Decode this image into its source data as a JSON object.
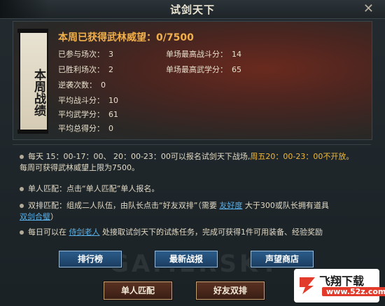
{
  "window": {
    "title": "试剑天下",
    "close_glyph": "✕"
  },
  "stats_panel": {
    "banner_text": "本周战绩",
    "prestige_label": "本周已获得武林威望：",
    "prestige_value": "0/7500",
    "left": [
      {
        "label": "已参与场次：",
        "value": "3"
      },
      {
        "label": "已胜利场次：",
        "value": "2"
      },
      {
        "label": "逆袭次数：",
        "value": "0"
      },
      {
        "label": "平均战斗分：",
        "value": "10"
      },
      {
        "label": "平均武学分：",
        "value": "61"
      },
      {
        "label": "平均总得分：",
        "value": "0"
      }
    ],
    "right": [
      {
        "label": "单场最高战斗分：",
        "value": "14"
      },
      {
        "label": "单场最高武学分：",
        "value": "65"
      }
    ]
  },
  "info": {
    "line1_a": "每天 15：00-17：00、 20：00-23：00可以报名试剑天下战场,",
    "line1_b": "周五20：00-23：00不开放。",
    "line1_c": "每周可获得武林威望上限为7500。",
    "line2": "单人匹配：点击“单人匹配”单人报名。",
    "line3_a": "双排匹配：组成二人队伍，由队长点击“好友双排”（需要 ",
    "line3_link1": "友好度",
    "line3_b": " 大于300或队长拥有道具",
    "line3_link2": "双剑合璧",
    "line3_c": "）",
    "line4_a": "每日可以在 ",
    "line4_link": "侍剑老人",
    "line4_b": " 处接取试剑天下的试炼任务，完成可获得1件可用装备、经验奖励"
  },
  "buttons": {
    "leaderboard": "排行榜",
    "latest_report": "最新战报",
    "prestige_shop": "声望商店",
    "solo_match": "单人匹配",
    "duo_match": "好友双排"
  },
  "watermark": "GAMERSKY",
  "logo": {
    "name": "飞翔下载",
    "url": "www.52z.com"
  },
  "colors": {
    "accent_gold": "#f1b04a",
    "link_blue": "#5ab0e6",
    "button_blue": "#2b5c8a"
  }
}
